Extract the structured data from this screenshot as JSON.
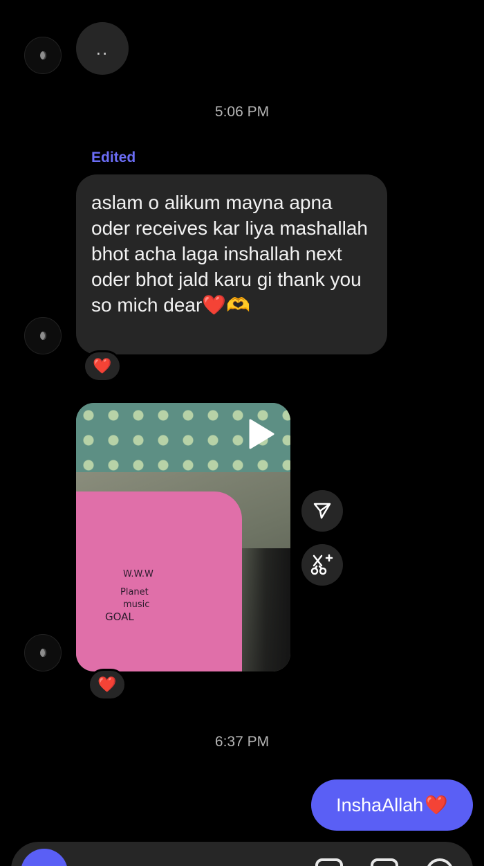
{
  "thread": {
    "typing_indicator": "..",
    "timestamp_1": "5:06 PM",
    "edited_label": "Edited",
    "message_text": "aslam o alikum mayna apna oder  receives kar liya mashallah bhot acha laga inshallah next oder bhot jald karu gi thank you so mich dear",
    "message_emoji": "❤️🫶",
    "reaction_1": "❤️",
    "reaction_2": "❤️",
    "timestamp_2": "6:37 PM",
    "sent_message": "InshaAllah",
    "sent_emoji": "❤️"
  },
  "video": {
    "shirt_text": [
      "W.W.W",
      "Planet",
      "music",
      "GOAL"
    ]
  },
  "icons": {
    "play": "play-icon",
    "share": "send-icon",
    "remix": "remix-icon",
    "camera": "camera-icon"
  },
  "colors": {
    "background": "#000000",
    "bubble_received": "#262626",
    "bubble_sent": "#5a5ff5",
    "edited_label": "#6b6df5",
    "heart": "#ff1f2d"
  }
}
